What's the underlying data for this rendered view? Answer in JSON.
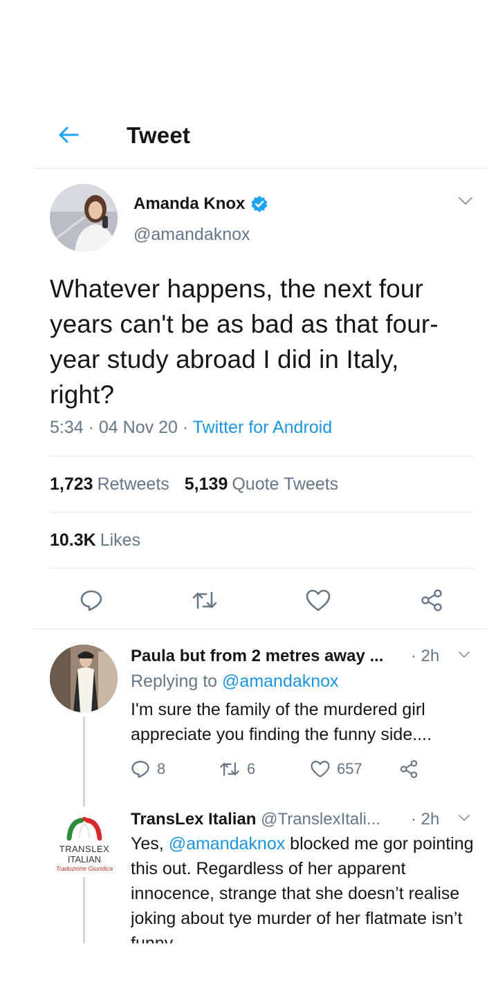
{
  "header": {
    "title": "Tweet"
  },
  "tweet": {
    "author_name": "Amanda Knox",
    "author_handle": "@amandaknox",
    "text": "Whatever happens, the next four years can't be as bad as that four-year study abroad I did in Italy, right?",
    "time": "5:34",
    "date": "04 Nov 20",
    "sep": "·",
    "source": "Twitter for Android",
    "retweets_count": "1,723",
    "retweets_label": "Retweets",
    "quotes_count": "5,139",
    "quotes_label": "Quote Tweets",
    "likes_count": "10.3K",
    "likes_label": "Likes"
  },
  "replies": [
    {
      "name": "Paula but from 2 metres away ...",
      "time": "· 2h",
      "replying_prefix": "Replying to",
      "replying_handle": "@amandaknox",
      "text": "I'm sure the family of the murdered girl appreciate you finding the funny side....",
      "reply_count": "8",
      "retweet_count": "6",
      "like_count": "657"
    },
    {
      "name": "TransLex Italian",
      "handle": "@TranslexItali...",
      "time": "· 2h",
      "text_prefix": "Yes,",
      "mention": "@amandaknox",
      "text": "blocked me gor pointing this out. Regardless of her apparent innocence, strange that she doesn’t realise joking about tye murder of her flatmate isn’t funny",
      "logo_line1": "TRANSLEX",
      "logo_line2": "ITALIAN",
      "logo_line3": "Traduzione Giuridica"
    }
  ],
  "colors": {
    "accent": "#1da1f2",
    "link": "#1b95e0",
    "muted": "#657786",
    "text": "#14171a",
    "divider": "#e1e8ed"
  },
  "icons": [
    "back-arrow-icon",
    "verified-badge-icon",
    "chevron-down-icon",
    "reply-icon",
    "retweet-icon",
    "like-icon",
    "share-icon"
  ]
}
